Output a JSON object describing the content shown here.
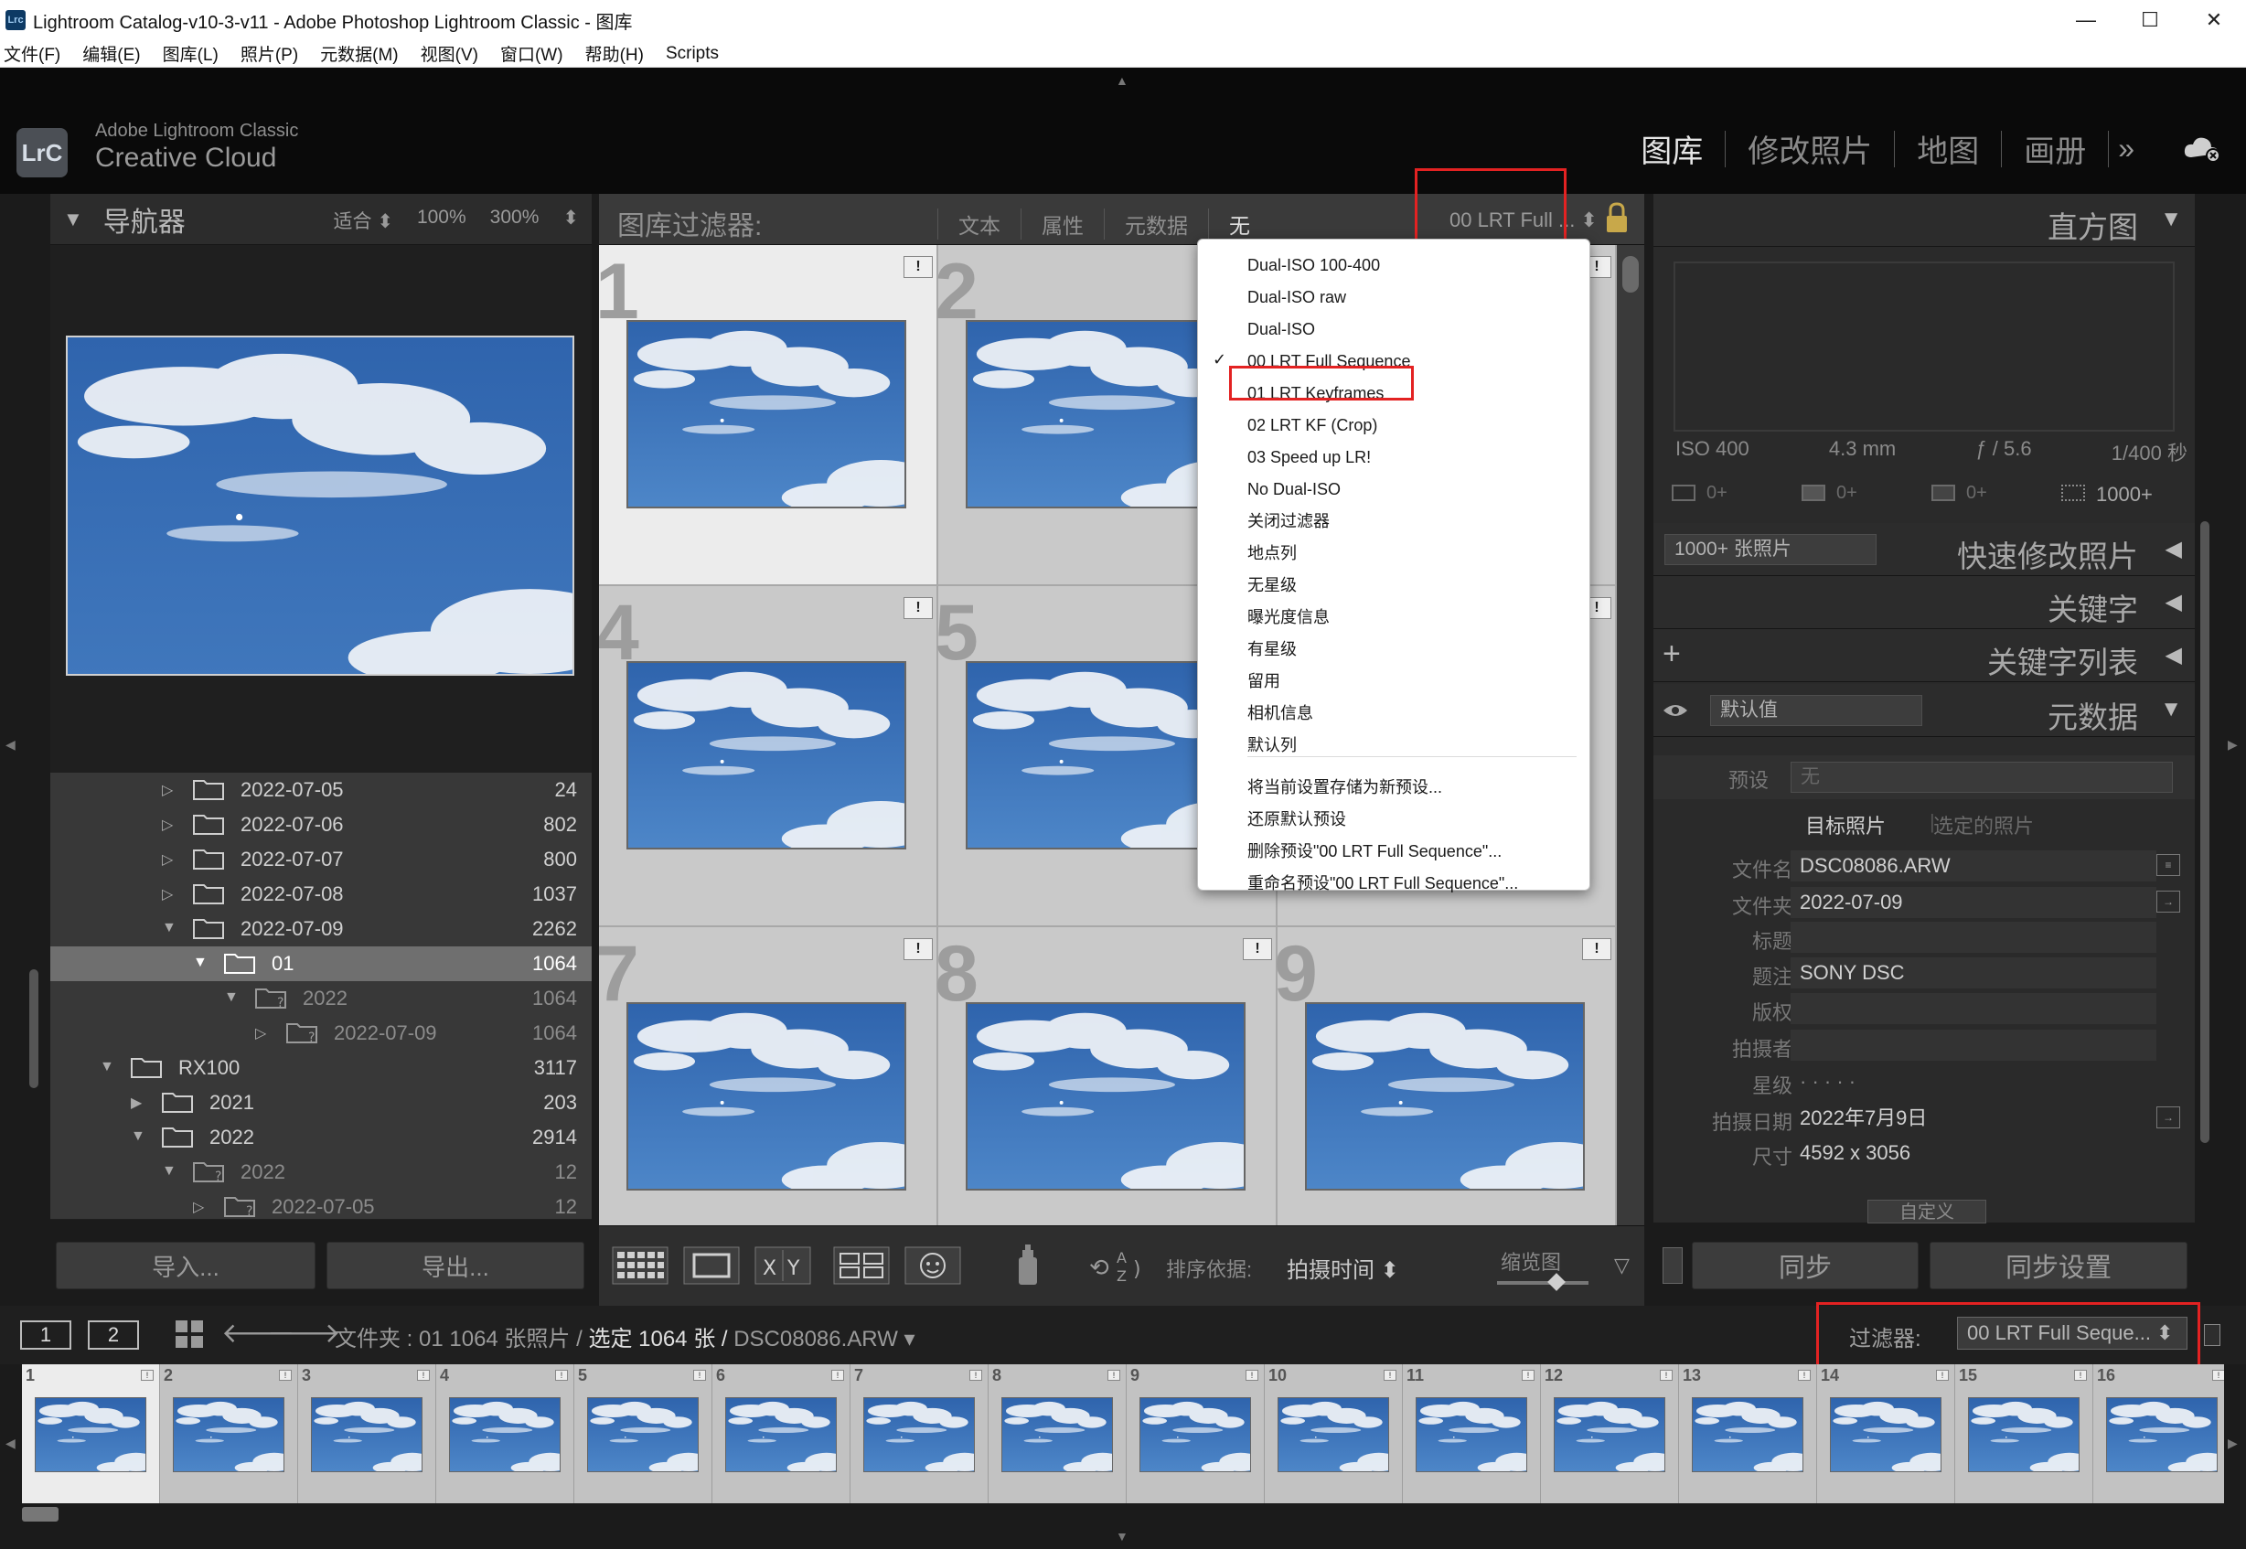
{
  "window": {
    "title": "Lightroom Catalog-v10-3-v11 - Adobe Photoshop Lightroom Classic - 图库",
    "app_icon": "Lrc",
    "controls": [
      "—",
      "☐",
      "✕"
    ]
  },
  "menubar": [
    "文件(F)",
    "编辑(E)",
    "图库(L)",
    "照片(P)",
    "元数据(M)",
    "视图(V)",
    "窗口(W)",
    "帮助(H)",
    "Scripts"
  ],
  "identity": {
    "logo": "LrC",
    "line1": "Adobe Lightroom Classic",
    "line2": "Creative Cloud",
    "modules": [
      "图库",
      "修改照片",
      "地图",
      "画册"
    ],
    "more": "»"
  },
  "navigator": {
    "title": "导航器",
    "zoom": [
      "适合 ⬍",
      "100%",
      "300%",
      "⬍"
    ]
  },
  "folders": [
    {
      "name": "2022-07-05",
      "count": "24",
      "twisty": "▷"
    },
    {
      "name": "2022-07-06",
      "count": "802",
      "twisty": "▷"
    },
    {
      "name": "2022-07-07",
      "count": "800",
      "twisty": "▷"
    },
    {
      "name": "2022-07-08",
      "count": "1037",
      "twisty": "▷"
    },
    {
      "name": "2022-07-09",
      "count": "2262",
      "twisty": "▼"
    },
    {
      "name": "01",
      "count": "1064",
      "twisty": "▼"
    },
    {
      "name": "2022",
      "count": "1064",
      "twisty": "▼"
    },
    {
      "name": "2022-07-09",
      "count": "1064",
      "twisty": "▷"
    },
    {
      "name": "RX100",
      "count": "3117",
      "twisty": "▼"
    },
    {
      "name": "2021",
      "count": "203",
      "twisty": "▶"
    },
    {
      "name": "2022",
      "count": "2914",
      "twisty": "▼"
    },
    {
      "name": "2022",
      "count": "12",
      "twisty": "▼"
    },
    {
      "name": "2022-07-05",
      "count": "12",
      "twisty": "▷"
    }
  ],
  "left_buttons": {
    "import": "导入...",
    "export": "导出..."
  },
  "filter_bar": {
    "title": "图库过滤器:",
    "options": [
      "文本",
      "属性",
      "元数据",
      "无"
    ],
    "preset": "00 LRT Full ... ⬍"
  },
  "grid": {
    "cells": [
      {
        "num": "1",
        "badge": "!"
      },
      {
        "num": "2",
        "badge": "!"
      },
      {
        "num": "3",
        "badge": "!"
      },
      {
        "num": "4",
        "badge": "!"
      },
      {
        "num": "5",
        "badge": "!"
      },
      {
        "num": "6",
        "badge": "!"
      },
      {
        "num": "7",
        "badge": "!"
      },
      {
        "num": "8",
        "badge": "!"
      },
      {
        "num": "9",
        "badge": "!"
      }
    ]
  },
  "dropdown": {
    "checked_index": 3,
    "items": [
      "Dual-ISO 100-400",
      "Dual-ISO raw",
      "Dual-ISO",
      "00 LRT Full Sequence",
      "01 LRT Keyframes",
      "02 LRT KF (Crop)",
      "03 Speed up LR!",
      "No Dual-ISO",
      "关闭过滤器",
      "地点列",
      "无星级",
      "曝光度信息",
      "有星级",
      "留用",
      "相机信息",
      "默认列"
    ],
    "actions": [
      "将当前设置存储为新预设...",
      "还原默认预设",
      "删除预设\"00 LRT Full Sequence\"...",
      "重命名预设\"00 LRT Full Sequence\"..."
    ]
  },
  "toolbar": {
    "sort_label": "排序依据:",
    "sort_value": "拍摄时间 ⬍",
    "thumb_label": "缩览图",
    "menu": "▽"
  },
  "right_panel": {
    "histogram_title": "直方图",
    "exif": [
      "ISO 400",
      "4.3 mm",
      "ƒ / 5.6",
      "1/400 秒"
    ],
    "orig": [
      "0+",
      "0+",
      "0+",
      "1000+"
    ],
    "quick_select": "1000+ 张照片",
    "quick_title": "快速修改照片",
    "keywords_title": "关键字",
    "keyword_list_title": "关键字列表",
    "plus": "+",
    "metadata_select": "默认值",
    "metadata_title": "元数据",
    "preset_label": "预设",
    "preset_value": "无",
    "tab_target": "目标照片",
    "tab_selected": "选定的照片",
    "fields": [
      {
        "label": "文件名",
        "value": "DSC08086.ARW",
        "go": "≡"
      },
      {
        "label": "文件夹",
        "value": "2022-07-09",
        "go": "→"
      },
      {
        "label": "标题",
        "value": "",
        "go": ""
      },
      {
        "label": "题注",
        "value": "SONY DSC",
        "go": ""
      },
      {
        "label": "版权",
        "value": "",
        "go": ""
      },
      {
        "label": "拍摄者",
        "value": "",
        "go": ""
      },
      {
        "label": "星级",
        "value": "·  ·  ·  ·  ·",
        "go": ""
      },
      {
        "label": "拍摄日期",
        "value": "2022年7月9日",
        "go": "→"
      },
      {
        "label": "尺寸",
        "value": "4592 x 3056",
        "go": ""
      }
    ],
    "customize": "自定义",
    "sync": "同步",
    "sync_settings": "同步设置"
  },
  "filmstrip_bar": {
    "screen1": "1",
    "screen2": "2",
    "folder_label": "文件夹 : 01",
    "count": "1064 张照片 /",
    "selected_prefix": "选定",
    "selected_count": "1064",
    "selected_suffix": "张 /",
    "filename": "DSC08086.ARW ▾",
    "filter_label": "过滤器:",
    "filter_value": "00 LRT Full Seque... ⬍"
  },
  "filmstrip": [
    "1",
    "2",
    "3",
    "4",
    "5",
    "6",
    "7",
    "8",
    "9",
    "10",
    "11",
    "12",
    "13",
    "14",
    "15",
    "16"
  ],
  "colors": {
    "highlight": "#e32222",
    "sky": "#3a6fb4"
  }
}
